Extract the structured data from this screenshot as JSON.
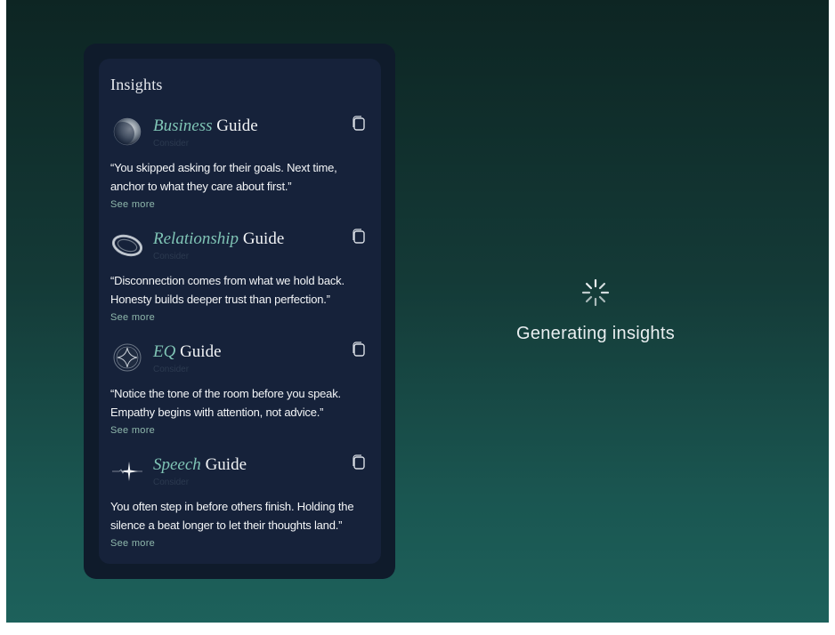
{
  "panel": {
    "title": "Insights",
    "guides": [
      {
        "accent": "Business",
        "name": "Guide",
        "subtitle": "Consider",
        "icon": "moon-sphere-icon",
        "quote": "“You skipped asking for their goals. Next time, anchor to what they care about first.”",
        "see_more": "See more"
      },
      {
        "accent": "Relationship",
        "name": "Guide",
        "subtitle": "Consider",
        "icon": "ring-orbit-icon",
        "quote": "“Disconnection comes from what we hold back. Honesty builds deeper trust than perfection.”",
        "see_more": "See more"
      },
      {
        "accent": "EQ",
        "name": "Guide",
        "subtitle": "Consider",
        "icon": "sparkle-sphere-icon",
        "quote": "“Notice the tone of the room before you speak. Empathy begins with attention, not advice.”",
        "see_more": "See more"
      },
      {
        "accent": "Speech",
        "name": "Guide",
        "subtitle": "Consider",
        "icon": "sound-spark-icon",
        "quote": "You often step in before others finish. Holding the silence a beat longer to let their thoughts land.”",
        "see_more": "See more"
      }
    ]
  },
  "status": {
    "text": "Generating insights",
    "icon": "spinner-icon"
  },
  "colors": {
    "accent": "#7fc4b5",
    "panel_bg": "#0f1b2b",
    "card_bg": "#16223a"
  }
}
